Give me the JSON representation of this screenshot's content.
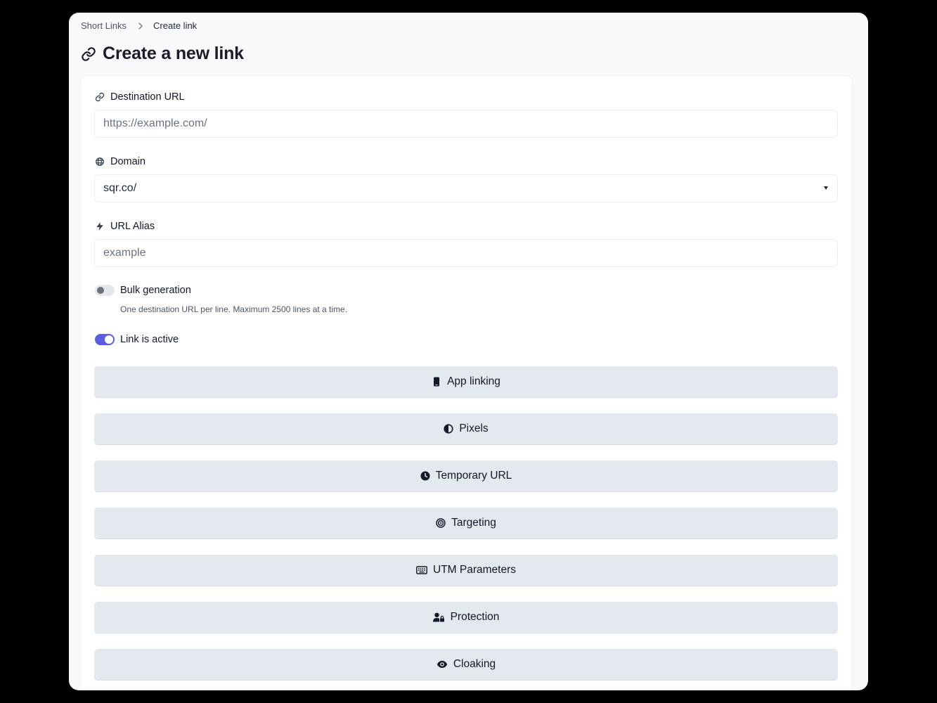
{
  "breadcrumb": {
    "parent": "Short Links",
    "current": "Create link"
  },
  "page": {
    "title": "Create a new link"
  },
  "form": {
    "destination": {
      "label": "Destination URL",
      "placeholder": "https://example.com/"
    },
    "domain": {
      "label": "Domain",
      "selected": "sqr.co/"
    },
    "alias": {
      "label": "URL Alias",
      "placeholder": "example"
    },
    "bulk": {
      "label": "Bulk generation",
      "helper": "One destination URL per line. Maximum 2500 lines at a time.",
      "enabled": false
    },
    "active": {
      "label": "Link is active",
      "enabled": true
    }
  },
  "sections": [
    {
      "label": "App linking",
      "icon": "mobile-icon"
    },
    {
      "label": "Pixels",
      "icon": "half-circle-icon"
    },
    {
      "label": "Temporary URL",
      "icon": "clock-icon"
    },
    {
      "label": "Targeting",
      "icon": "target-icon"
    },
    {
      "label": "UTM Parameters",
      "icon": "keyboard-icon"
    },
    {
      "label": "Protection",
      "icon": "user-lock-icon"
    },
    {
      "label": "Cloaking",
      "icon": "eye-icon"
    }
  ],
  "colors": {
    "accent": "#5a5fe0",
    "section_bg": "#e4e8ef",
    "page_bg": "#f8f9fb"
  }
}
